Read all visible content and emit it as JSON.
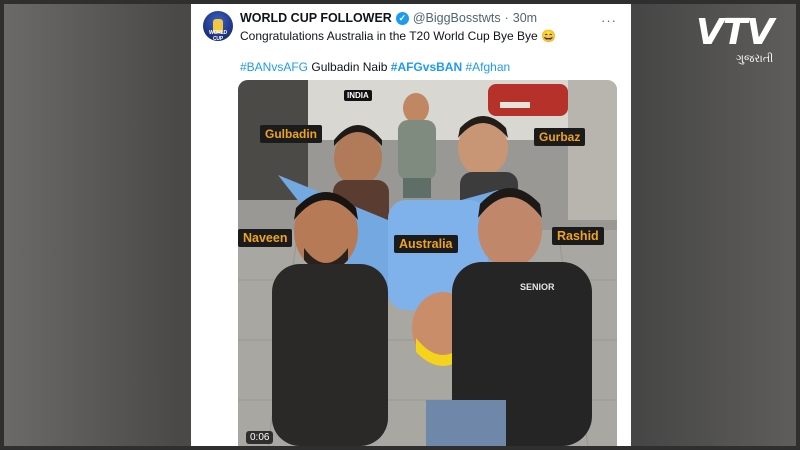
{
  "tweet": {
    "author_name": "WORLD CUP FOLLOWER",
    "avatar_text": "WORLD CUP",
    "handle": "@BiggBosstwts",
    "separator": "·",
    "time": "30m",
    "more": "···",
    "text": "Congratulations Australia in the T20 World Cup Bye Bye 😄",
    "hashtags": [
      {
        "text": "#BANvsAFG",
        "style": "link"
      },
      {
        "text": "Gulbadin Naib",
        "style": "plain"
      },
      {
        "text": "#AFGvsBAN",
        "style": "link-bold"
      },
      {
        "text": "#Afghan",
        "style": "link"
      }
    ],
    "verified_icon": "verified-badge-icon"
  },
  "media": {
    "labels": {
      "india": "INDIA",
      "gulbadin": "Gulbadin",
      "gurbaz": "Gurbaz",
      "naveen": "Naveen",
      "australia": "Australia",
      "rashid": "Rashid"
    },
    "shirt_text": "SENIOR",
    "duration": "0:06"
  },
  "watermark": {
    "main": "VTV",
    "sub": "ગુજરાતી"
  },
  "colors": {
    "link": "#1d9bf0",
    "label_text": "#f0a31f",
    "label_bg": "#1b1b1b"
  }
}
